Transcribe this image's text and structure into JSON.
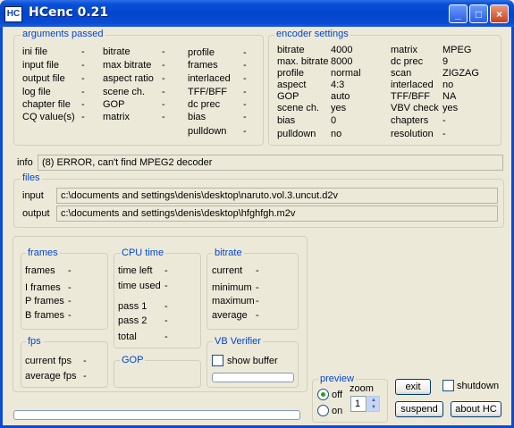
{
  "window": {
    "title": "HCenc 0.21",
    "icon": "HC",
    "controls": [
      "_",
      "□",
      "×"
    ]
  },
  "arguments": {
    "legend": "arguments passed",
    "col1": [
      {
        "label": "ini file",
        "value": "-"
      },
      {
        "label": "input file",
        "value": "-"
      },
      {
        "label": "output file",
        "value": "-"
      },
      {
        "label": "log file",
        "value": "-"
      },
      {
        "label": "chapter file",
        "value": "-"
      },
      {
        "label": "CQ value(s)",
        "value": "-"
      }
    ],
    "col2": [
      {
        "label": "bitrate",
        "value": "-"
      },
      {
        "label": "max bitrate",
        "value": "-"
      },
      {
        "label": "aspect ratio",
        "value": "-"
      },
      {
        "label": "scene ch.",
        "value": "-"
      },
      {
        "label": "GOP",
        "value": "-"
      },
      {
        "label": "matrix",
        "value": "-"
      }
    ],
    "col3": [
      {
        "label": "profile",
        "value": "-"
      },
      {
        "label": "frames",
        "value": "-"
      },
      {
        "label": "interlaced",
        "value": "-"
      },
      {
        "label": "TFF/BFF",
        "value": "-"
      },
      {
        "label": "dc prec",
        "value": "-"
      },
      {
        "label": "bias",
        "value": "-"
      },
      {
        "label": "pulldown",
        "value": "-"
      }
    ]
  },
  "encoder": {
    "legend": "encoder settings",
    "col1": [
      {
        "label": "bitrate",
        "value": "4000"
      },
      {
        "label": "max. bitrate",
        "value": "8000"
      },
      {
        "label": "profile",
        "value": "normal"
      },
      {
        "label": "aspect",
        "value": "4:3"
      },
      {
        "label": "GOP",
        "value": "auto"
      },
      {
        "label": "scene ch.",
        "value": "yes"
      },
      {
        "label": "bias",
        "value": "0"
      },
      {
        "label": "pulldown",
        "value": "no"
      }
    ],
    "col2": [
      {
        "label": "matrix",
        "value": "MPEG"
      },
      {
        "label": "dc prec",
        "value": "9"
      },
      {
        "label": "scan",
        "value": "ZIGZAG"
      },
      {
        "label": "interlaced",
        "value": "no"
      },
      {
        "label": "TFF/BFF",
        "value": "NA"
      },
      {
        "label": "VBV check",
        "value": "yes"
      },
      {
        "label": "chapters",
        "value": "-"
      },
      {
        "label": "resolution",
        "value": "-"
      }
    ]
  },
  "info": {
    "label": "info",
    "value": "(8) ERROR, can't find MPEG2 decoder"
  },
  "files": {
    "legend": "files",
    "input_label": "input",
    "input_value": "c:\\documents and settings\\denis\\desktop\\naruto.vol.3.uncut.d2v",
    "output_label": "output",
    "output_value": "c:\\documents and settings\\denis\\desktop\\hfghfgh.m2v"
  },
  "frames": {
    "legend": "frames",
    "rows": [
      {
        "label": "frames",
        "value": "-"
      },
      {
        "label": "I frames",
        "value": "-"
      },
      {
        "label": "P frames",
        "value": "-"
      },
      {
        "label": "B frames",
        "value": "-"
      }
    ]
  },
  "cpu": {
    "legend": "CPU time",
    "rows": [
      {
        "label": "time left",
        "value": "-"
      },
      {
        "label": "time used",
        "value": "-"
      },
      {
        "label": "pass 1",
        "value": "-"
      },
      {
        "label": "pass 2",
        "value": "-"
      },
      {
        "label": "total",
        "value": "-"
      }
    ]
  },
  "bitrate": {
    "legend": "bitrate",
    "rows": [
      {
        "label": "current",
        "value": "-"
      },
      {
        "label": "minimum",
        "value": "-"
      },
      {
        "label": "maximum",
        "value": "-"
      },
      {
        "label": "average",
        "value": "-"
      }
    ]
  },
  "fps": {
    "legend": "fps",
    "rows": [
      {
        "label": "current fps",
        "value": "-"
      },
      {
        "label": "average fps",
        "value": "-"
      }
    ]
  },
  "gop": {
    "legend": "GOP"
  },
  "vbv": {
    "legend": "VB Verifier",
    "show_buffer_label": "show buffer",
    "show_buffer_checked": false,
    "buffer_level": 0
  },
  "preview": {
    "legend": "preview",
    "off_label": "off",
    "on_label": "on",
    "selected": "off",
    "zoom_label": "zoom",
    "zoom_value": "1"
  },
  "buttons": {
    "exit": "exit",
    "suspend": "suspend",
    "about": "about  HC",
    "shutdown_label": "shutdown",
    "shutdown_checked": false
  },
  "progress": {
    "value": 0
  },
  "colors": {
    "title_bar": "#0A4BD4",
    "legend": "#0046D5",
    "background": "#ECE9D8"
  }
}
